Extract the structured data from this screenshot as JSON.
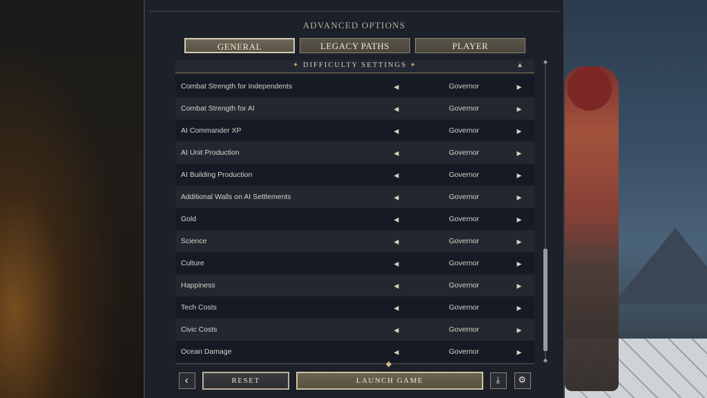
{
  "title": "ADVANCED OPTIONS",
  "tabs": [
    {
      "label": "GENERAL",
      "active": true
    },
    {
      "label": "LEGACY PATHS",
      "active": false
    },
    {
      "label": "PLAYER",
      "active": false
    }
  ],
  "section": {
    "title": "DIFFICULTY SETTINGS"
  },
  "settings": [
    {
      "label": "Combat Strength for Independents",
      "value": "Governor"
    },
    {
      "label": "Combat Strength for AI",
      "value": "Governor"
    },
    {
      "label": "AI Commander XP",
      "value": "Governor"
    },
    {
      "label": "AI Unit Production",
      "value": "Governor"
    },
    {
      "label": "AI Building Production",
      "value": "Governor"
    },
    {
      "label": "Additional Walls on AI Settlements",
      "value": "Governor"
    },
    {
      "label": "Gold",
      "value": "Governor"
    },
    {
      "label": "Science",
      "value": "Governor"
    },
    {
      "label": "Culture",
      "value": "Governor"
    },
    {
      "label": "Happiness",
      "value": "Governor"
    },
    {
      "label": "Tech Costs",
      "value": "Governor"
    },
    {
      "label": "Civic Costs",
      "value": "Governor"
    },
    {
      "label": "Ocean Damage",
      "value": "Governor"
    }
  ],
  "footer": {
    "reset_label": "RESET",
    "launch_label": "LAUNCH GAME",
    "back_icon": "chevron-left-icon",
    "download_icon": "download-icon",
    "settings_icon": "gear-icon"
  },
  "colors": {
    "panel_bg": "#1b2029",
    "accent_gold": "#c9a560",
    "tab_active_border": "#d6cdb7"
  }
}
